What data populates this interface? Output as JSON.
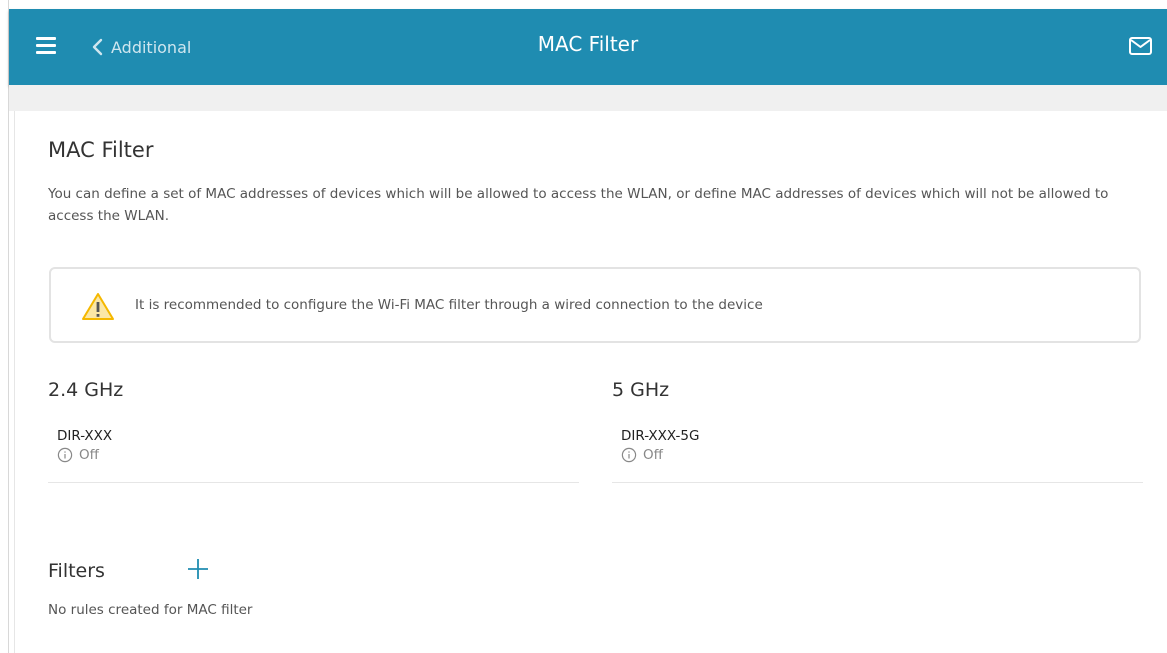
{
  "header": {
    "back_label": "Additional",
    "title": "MAC Filter",
    "color": "#1f8cb1"
  },
  "page": {
    "title": "MAC Filter",
    "description": "You can define a set of MAC addresses of devices which will be allowed to access the WLAN, or define MAC addresses of devices which will not be allowed to access the WLAN."
  },
  "notice": {
    "text": "It is recommended to configure the Wi-Fi MAC filter through a wired connection to the device",
    "icon": "warning-icon",
    "icon_color": "#f5b800"
  },
  "bands": [
    {
      "title": "2.4 GHz",
      "ssid": "DIR-XXX",
      "status": "Off"
    },
    {
      "title": "5 GHz",
      "ssid": "DIR-XXX-5G",
      "status": "Off"
    }
  ],
  "filters": {
    "title": "Filters",
    "empty_text": "No rules created for MAC filter",
    "add_icon": "plus-icon"
  }
}
